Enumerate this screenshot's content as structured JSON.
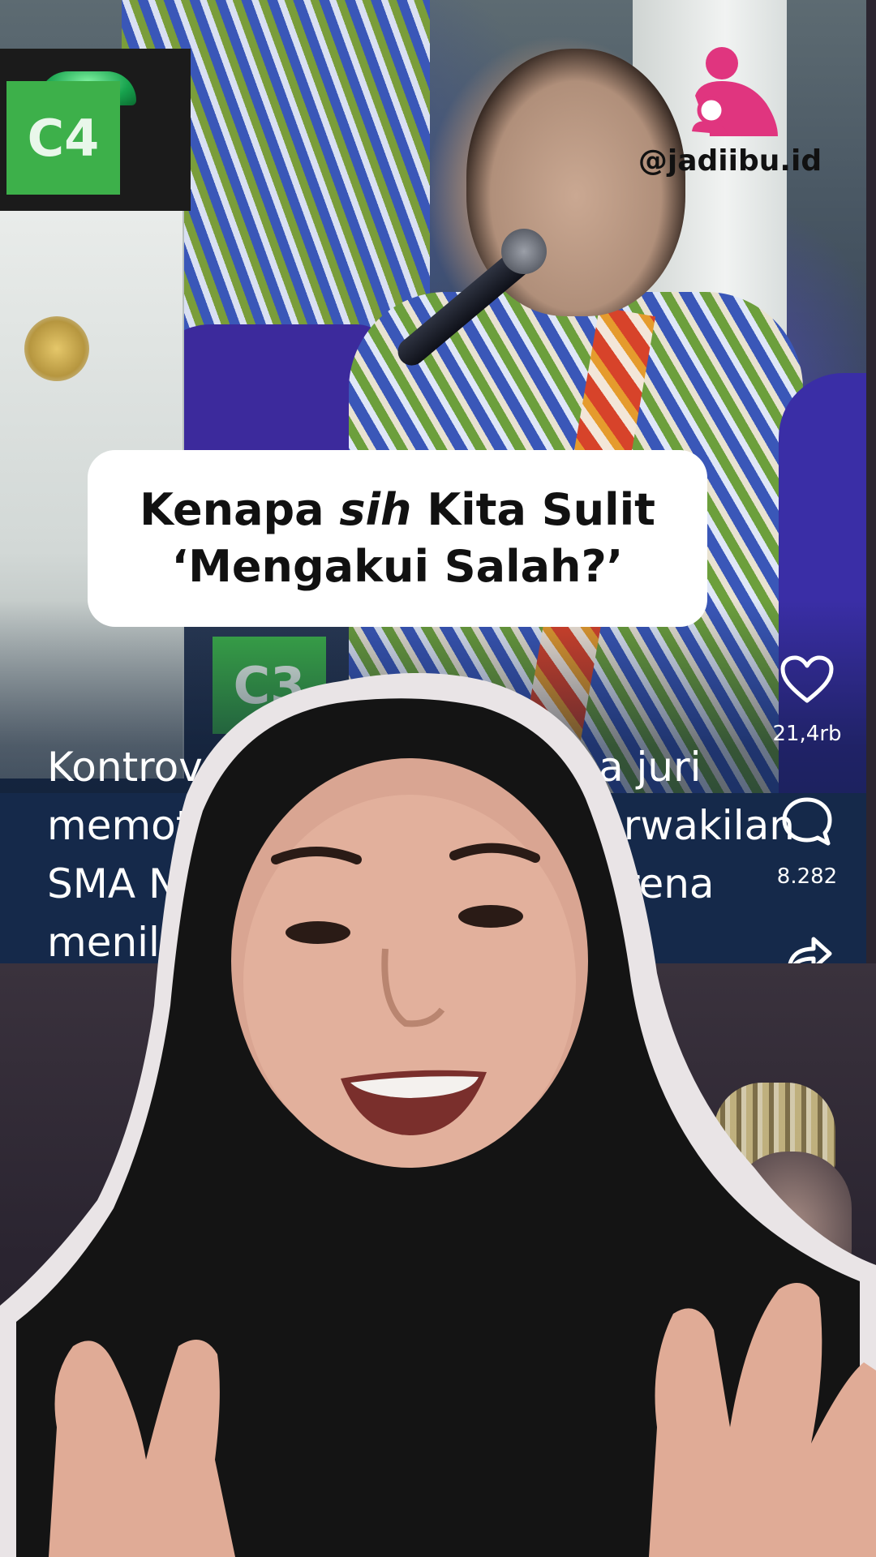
{
  "brand": {
    "handle": "@jadiibu.id",
    "logo_icon": "mother-child-logo-icon",
    "accent_color": "#e0357f"
  },
  "background_video": {
    "podium_label": "C4",
    "podium_label_2": "C3"
  },
  "headline": {
    "line1_pre": "Kenapa ",
    "line1_emph": "sih",
    "line1_post": " Kita Sulit",
    "line2": "‘Mengakui Salah?’"
  },
  "caption": {
    "lines": [
      {
        "left": "Kontrov",
        "right": "a juri"
      },
      {
        "left": "memot",
        "right": "erwakilan"
      },
      {
        "left": "SMA N",
        "right": "rena"
      },
      {
        "left": "menil",
        "right": ""
      }
    ]
  },
  "actions": {
    "like": {
      "icon": "heart-icon",
      "count": "21,4rb"
    },
    "comment": {
      "icon": "comment-icon",
      "count": "8.282"
    },
    "share": {
      "icon": "share-icon"
    }
  }
}
